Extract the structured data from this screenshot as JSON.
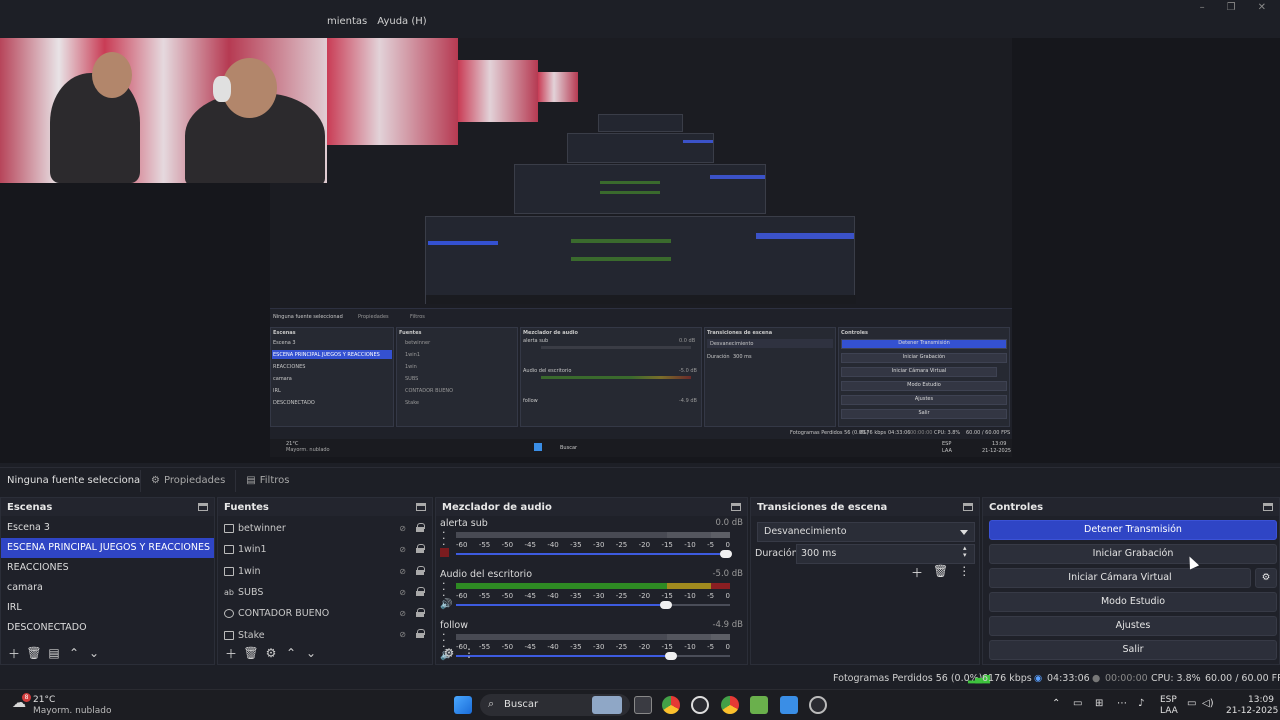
{
  "menu": {
    "items": [
      "mientas",
      "Ayuda (H)"
    ]
  },
  "window_controls": {
    "minimize": "–",
    "maximize": "❐",
    "close": "✕"
  },
  "props_bar": {
    "no_source": "Ninguna fuente seleccionac",
    "properties": "Propiedades",
    "filters": "Filtros"
  },
  "scenes": {
    "title": "Escenas",
    "items": [
      "Escena 3",
      "ESCENA PRINCIPAL JUEGOS Y REACCIONES",
      "REACCIONES",
      "camara",
      "IRL",
      "DESCONECTADO"
    ],
    "active_index": 1
  },
  "sources": {
    "title": "Fuentes",
    "items": [
      "betwinner",
      "1win1",
      "1win",
      "SUBS",
      "CONTADOR BUENO",
      "Stake"
    ]
  },
  "mixer": {
    "title": "Mezclador de audio",
    "scale": [
      "-60",
      "-55",
      "-50",
      "-45",
      "-40",
      "-35",
      "-30",
      "-25",
      "-20",
      "-15",
      "-10",
      "-5",
      "0"
    ],
    "channels": [
      {
        "name": "alerta sub",
        "db": "0.0 dB",
        "level": 0,
        "volume": 1.0
      },
      {
        "name": "Audio del escritorio",
        "db": "-5.0 dB",
        "level": 0.93,
        "volume": 0.78
      },
      {
        "name": "follow",
        "db": "-4.9 dB",
        "level": 0,
        "volume": 0.8
      }
    ]
  },
  "transitions": {
    "title": "Transiciones de escena",
    "selected": "Desvanecimiento",
    "duration_label": "Duración",
    "duration_value": "300 ms"
  },
  "controls": {
    "title": "Controles",
    "stop_stream": "Detener Transmisión",
    "start_record": "Iniciar Grabación",
    "start_virtual_cam": "Iniciar Cámara Virtual",
    "studio_mode": "Modo Estudio",
    "settings": "Ajustes",
    "exit": "Salir"
  },
  "status": {
    "dropped_frames": "Fotogramas Perdidos 56 (0.0%)",
    "bitrate": "6176 kbps",
    "stream_time": "04:33:06",
    "record_time": "00:00:00",
    "cpu": "CPU: 3.8%",
    "fps": "60.00 / 60.00 FPS"
  },
  "taskbar": {
    "weather_temp": "21°C",
    "weather_desc": "Mayorm. nublado",
    "weather_badge": "8",
    "search": "Buscar",
    "lang_top": "ESP",
    "lang_bottom": "LAA",
    "time": "13:09",
    "date": "21-12-2025"
  },
  "mini": {
    "no_source": "Ninguna fuente seleccionad",
    "properties": "Propiedades",
    "filters": "Filtros",
    "scenes_title": "Escenas",
    "sources_title": "Fuentes",
    "mixer_title": "Mezclador de audio",
    "transitions_title": "Transiciones de escena",
    "controls_title": "Controles",
    "scene_items": [
      "Escena 3",
      "ESCENA PRINCIPAL JUEGOS Y REACCIONES",
      "REACCIONES",
      "camara",
      "IRL",
      "DESCONECTADO"
    ],
    "source_items": [
      "betwinner",
      "1win1",
      "1win",
      "SUBS",
      "CONTADOR BUENO",
      "Stake"
    ],
    "mixer_channels": [
      "alerta sub",
      "Audio del escritorio",
      "follow"
    ],
    "mixer_dbs": [
      "0.0 dB",
      "-5.0 dB",
      "-4.9 dB"
    ],
    "transition_select": "Desvanecimiento",
    "duration_label": "Duración",
    "duration_value": "300 ms",
    "buttons": [
      "Detener Transmisión",
      "Iniciar Grabación",
      "Iniciar Cámara Virtual",
      "Modo Estudio",
      "Ajustes",
      "Salir"
    ],
    "status_dropped": "Fotogramas Perdidos 56 (0.0%)",
    "status_kbps": "6176 kbps",
    "status_stream": "04:33:06",
    "status_record": "00:00:00",
    "status_cpu": "CPU: 3.8%",
    "status_fps": "60.00 / 60.00 FPS",
    "weather_temp": "21°C",
    "weather_desc": "Mayorm. nublado",
    "search": "Buscar",
    "lang_top": "ESP",
    "lang_bottom": "LAA",
    "time": "13:09",
    "date": "21-12-2025"
  },
  "colors": {
    "accent": "#2f45c5",
    "bg": "#1d1f26",
    "panel": "#1f2129",
    "meter_green": "#2e8a23",
    "meter_yellow": "#a08a1e",
    "meter_red": "#8a1e22"
  }
}
